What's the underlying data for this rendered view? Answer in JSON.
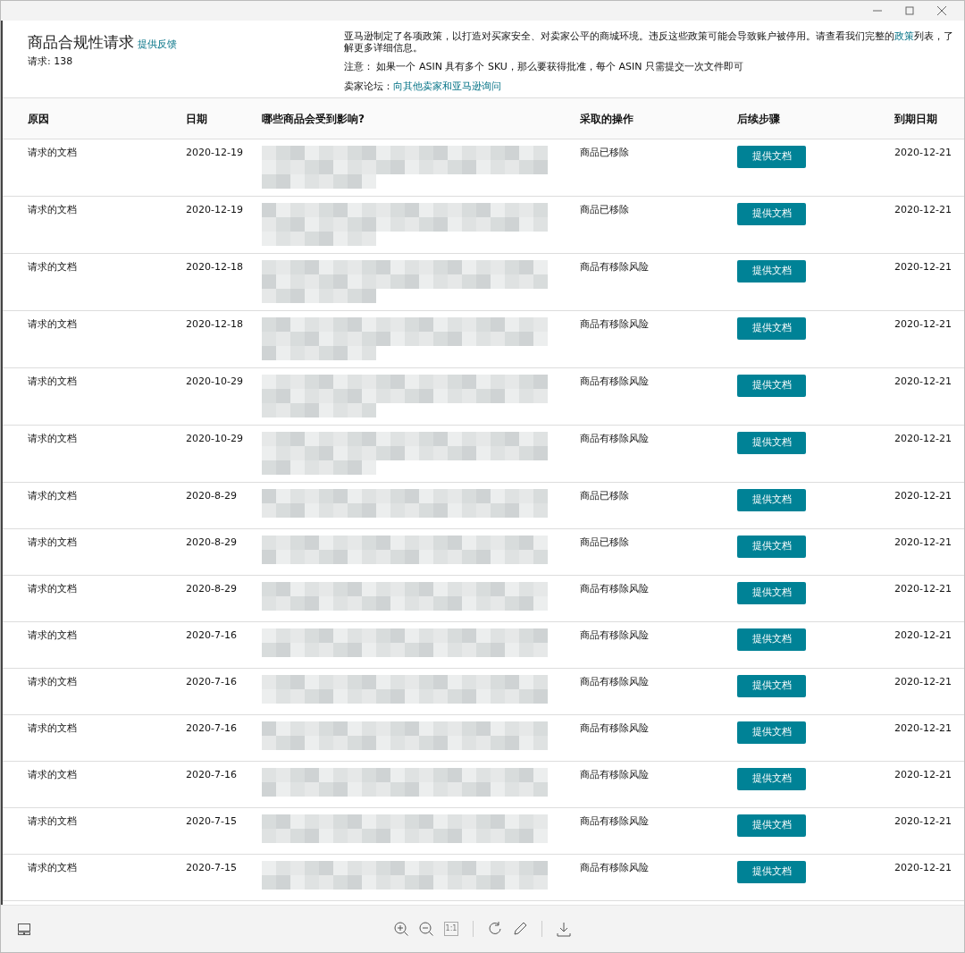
{
  "window": {
    "controls": [
      {
        "kind": "minimize"
      },
      {
        "kind": "maximize"
      },
      {
        "kind": "close"
      }
    ]
  },
  "header": {
    "title": "商品合规性请求",
    "feedback_link": "提供反馈",
    "count": "请求: 138",
    "policy_text_before": "亚马逊制定了各项政策，以打造对买家安全、对卖家公平的商城环境。违反这些政策可能会导致账户被停用。请查看我们完整的",
    "policy_link": "政策",
    "policy_text_after": "列表，了解更多详细信息。",
    "note": "注意： 如果一个 ASIN 具有多个 SKU，那么要获得批准，每个 ASIN 只需提交一次文件即可",
    "forum_label": "卖家论坛：",
    "forum_link": "向其他卖家和亚马逊询问"
  },
  "table": {
    "columns": [
      "原因",
      "日期",
      "哪些商品会受到影响?",
      "采取的操作",
      "后续步骤",
      "到期日期"
    ],
    "rows": [
      {
        "reason": "请求的文档",
        "date": "2020-12-19",
        "affected": {
          "kind": "tall"
        },
        "action": "商品已移除",
        "button": "提供文档",
        "due": "2020-12-21"
      },
      {
        "reason": "请求的文档",
        "date": "2020-12-19",
        "affected": {
          "kind": "tall"
        },
        "action": "商品已移除",
        "button": "提供文档",
        "due": "2020-12-21"
      },
      {
        "reason": "请求的文档",
        "date": "2020-12-18",
        "affected": {
          "kind": "tall"
        },
        "action": "商品有移除风险",
        "button": "提供文档",
        "due": "2020-12-21"
      },
      {
        "reason": "请求的文档",
        "date": "2020-12-18",
        "affected": {
          "kind": "tall"
        },
        "action": "商品有移除风险",
        "button": "提供文档",
        "due": "2020-12-21"
      },
      {
        "reason": "请求的文档",
        "date": "2020-10-29",
        "affected": {
          "kind": "tall"
        },
        "action": "商品有移除风险",
        "button": "提供文档",
        "due": "2020-12-21"
      },
      {
        "reason": "请求的文档",
        "date": "2020-10-29",
        "affected": {
          "kind": "tall"
        },
        "action": "商品有移除风险",
        "button": "提供文档",
        "due": "2020-12-21"
      },
      {
        "reason": "请求的文档",
        "date": "2020-8-29",
        "affected": {
          "kind": "short"
        },
        "action": "商品已移除",
        "button": "提供文档",
        "due": "2020-12-21"
      },
      {
        "reason": "请求的文档",
        "date": "2020-8-29",
        "affected": {
          "kind": "short"
        },
        "action": "商品已移除",
        "button": "提供文档",
        "due": "2020-12-21"
      },
      {
        "reason": "请求的文档",
        "date": "2020-8-29",
        "affected": {
          "kind": "short"
        },
        "action": "商品有移除风险",
        "button": "提供文档",
        "due": "2020-12-21"
      },
      {
        "reason": "请求的文档",
        "date": "2020-7-16",
        "affected": {
          "kind": "short"
        },
        "action": "商品有移除风险",
        "button": "提供文档",
        "due": "2020-12-21"
      },
      {
        "reason": "请求的文档",
        "date": "2020-7-16",
        "affected": {
          "kind": "short"
        },
        "action": "商品有移除风险",
        "button": "提供文档",
        "due": "2020-12-21"
      },
      {
        "reason": "请求的文档",
        "date": "2020-7-16",
        "affected": {
          "kind": "short"
        },
        "action": "商品有移除风险",
        "button": "提供文档",
        "due": "2020-12-21"
      },
      {
        "reason": "请求的文档",
        "date": "2020-7-16",
        "affected": {
          "kind": "short"
        },
        "action": "商品有移除风险",
        "button": "提供文档",
        "due": "2020-12-21"
      },
      {
        "reason": "请求的文档",
        "date": "2020-7-15",
        "affected": {
          "kind": "short"
        },
        "action": "商品有移除风险",
        "button": "提供文档",
        "due": "2020-12-21"
      },
      {
        "reason": "请求的文档",
        "date": "2020-7-15",
        "affected": {
          "kind": "short"
        },
        "action": "商品有移除风险",
        "button": "提供文档",
        "due": "2020-12-21"
      }
    ]
  },
  "viewer_toolbar": {
    "items": [
      {
        "kind": "zoom-in",
        "disabled": false
      },
      {
        "kind": "zoom-out",
        "disabled": false
      },
      {
        "kind": "actual-size",
        "label": "1:1",
        "disabled": true
      },
      {
        "kind": "separator"
      },
      {
        "kind": "rotate",
        "disabled": false
      },
      {
        "kind": "edit",
        "disabled": false
      },
      {
        "kind": "separator"
      },
      {
        "kind": "download",
        "disabled": false
      }
    ]
  }
}
